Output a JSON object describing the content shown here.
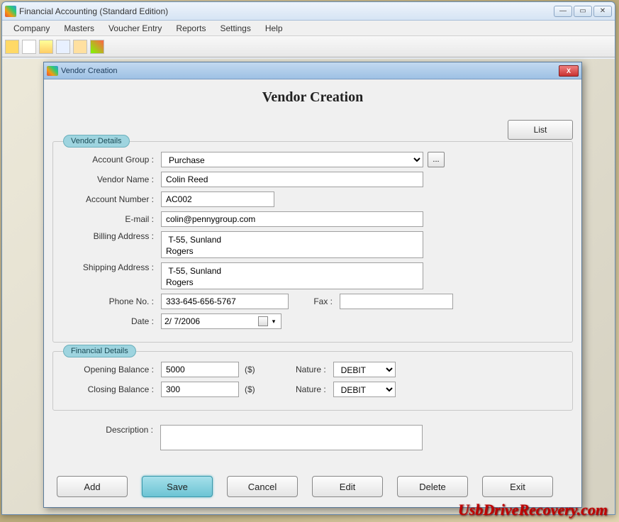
{
  "window": {
    "title": "Financial Accounting (Standard Edition)"
  },
  "menu": {
    "items": [
      "Company",
      "Masters",
      "Voucher Entry",
      "Reports",
      "Settings",
      "Help"
    ]
  },
  "dialog": {
    "title": "Vendor Creation",
    "heading": "Vendor Creation",
    "list_btn": "List",
    "vendor_section": "Vendor Details",
    "financial_section": "Financial Details",
    "labels": {
      "account_group": "Account Group :",
      "vendor_name": "Vendor Name :",
      "account_number": "Account Number :",
      "email": "E-mail :",
      "billing_address": "Billing Address :",
      "shipping_address": "Shipping Address :",
      "phone": "Phone No. :",
      "fax": "Fax :",
      "date": "Date :",
      "opening_balance": "Opening Balance :",
      "closing_balance": "Closing Balance :",
      "nature": "Nature :",
      "description": "Description :",
      "currency": "($)"
    },
    "values": {
      "account_group": "Purchase",
      "vendor_name": "Colin Reed",
      "account_number": "AC002",
      "email": "colin@pennygroup.com",
      "billing_address": " T-55, Sunland\nRogers",
      "shipping_address": " T-55, Sunland\nRogers",
      "phone": "333-645-656-5767",
      "fax": "",
      "date": " 2/  7/2006",
      "opening_balance": "5000",
      "closing_balance": "300",
      "nature1": "DEBIT",
      "nature2": "DEBIT",
      "description": ""
    },
    "buttons": {
      "add": "Add",
      "save": "Save",
      "cancel": "Cancel",
      "edit": "Edit",
      "delete": "Delete",
      "exit": "Exit",
      "browse": "..."
    }
  },
  "watermark": "UsbDriveRecovery.com"
}
